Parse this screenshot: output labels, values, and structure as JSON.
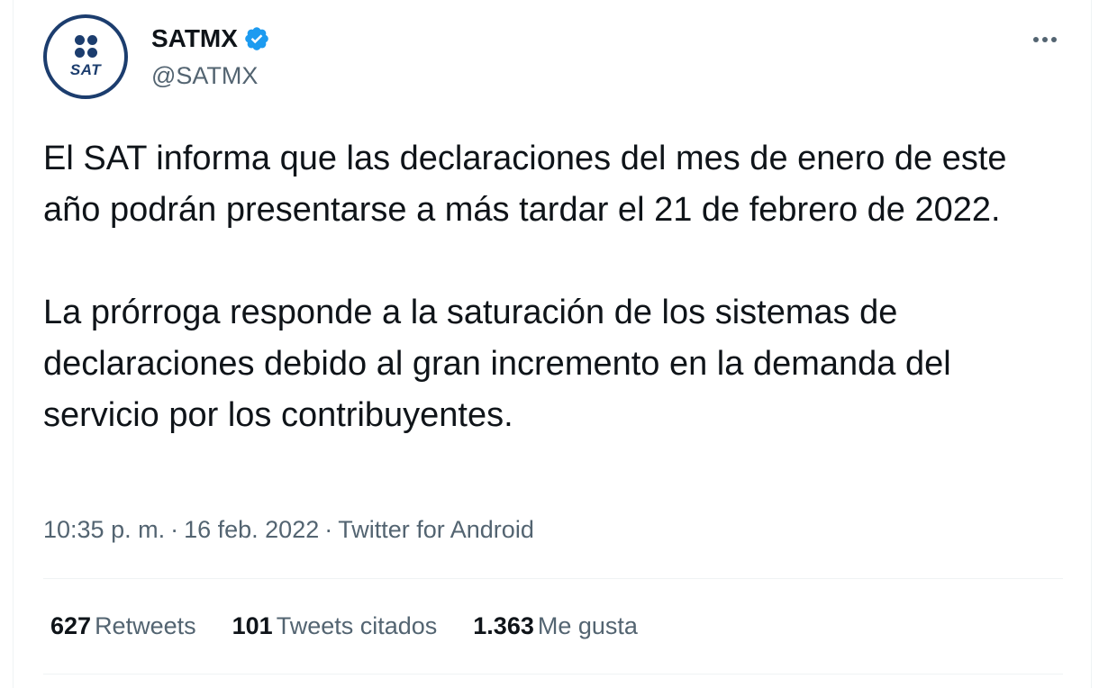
{
  "author": {
    "name": "SATMX",
    "handle": "@SATMX",
    "avatar_text": "SAT",
    "verified_icon": "verified-badge-icon"
  },
  "tweet": {
    "paragraphs": [
      "El SAT informa que las declaraciones del mes de enero de este año podrán presentarse a más tardar el 21 de febrero de 2022.",
      "La prórroga responde a la saturación de los sistemas de declaraciones debido al gran incremento en la demanda del servicio por los contribuyentes."
    ]
  },
  "meta": {
    "time": "10:35 p. m.",
    "date": "16 feb. 2022",
    "source": "Twitter for Android",
    "separator": "·"
  },
  "stats": {
    "retweets_count": "627",
    "retweets_label": "Retweets",
    "quotes_count": "101",
    "quotes_label": "Tweets citados",
    "likes_count": "1.363",
    "likes_label": "Me gusta"
  },
  "colors": {
    "primary_text": "#0f1419",
    "secondary_text": "#536471",
    "verified_blue": "#1d9bf0",
    "sat_navy": "#1c3d6e",
    "divider": "#eff3f4"
  }
}
